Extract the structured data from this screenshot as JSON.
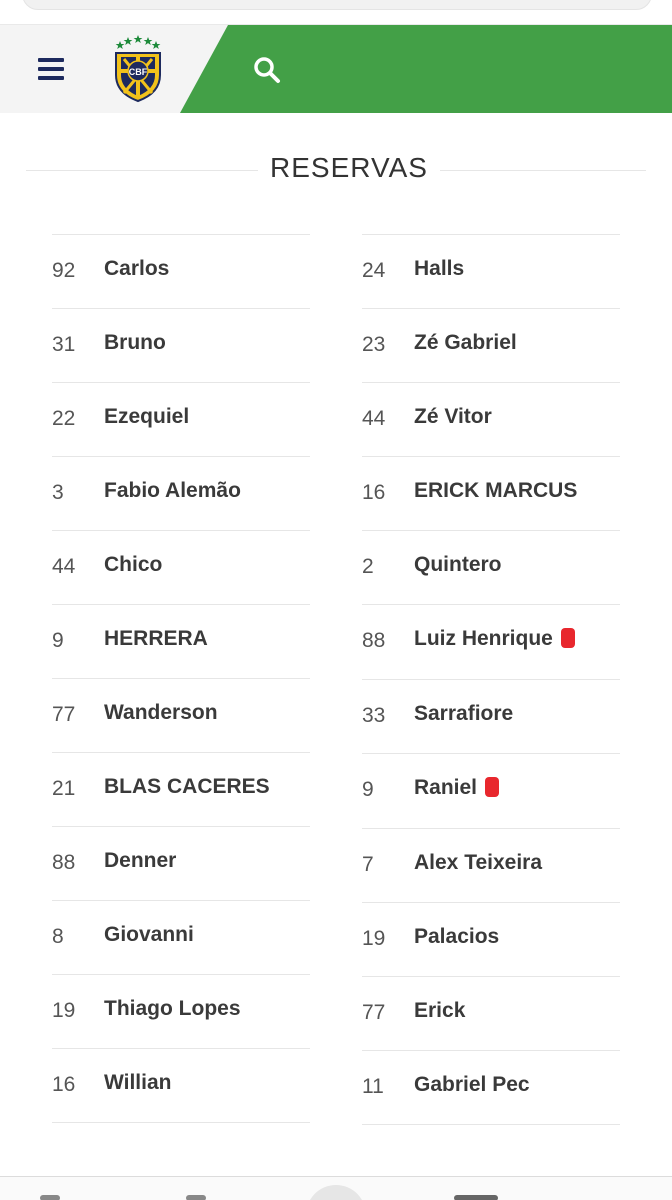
{
  "header": {
    "menu_icon": "hamburger-menu-icon",
    "logo_icon": "cbf-crest-icon",
    "logo_text": "CBF",
    "search_icon": "search-icon",
    "accent_color": "#43a047",
    "brand_navy": "#1d2a5e"
  },
  "section": {
    "title": "RESERVAS"
  },
  "left_column": [
    {
      "number": "92",
      "name": "Carlos",
      "red_card": false
    },
    {
      "number": "31",
      "name": "Bruno",
      "red_card": false
    },
    {
      "number": "22",
      "name": "Ezequiel",
      "red_card": false
    },
    {
      "number": "3",
      "name": "Fabio Alemão",
      "red_card": false
    },
    {
      "number": "44",
      "name": "Chico",
      "red_card": false
    },
    {
      "number": "9",
      "name": "HERRERA",
      "red_card": false
    },
    {
      "number": "77",
      "name": "Wanderson",
      "red_card": false
    },
    {
      "number": "21",
      "name": "BLAS CACERES",
      "red_card": false
    },
    {
      "number": "88",
      "name": "Denner",
      "red_card": false
    },
    {
      "number": "8",
      "name": "Giovanni",
      "red_card": false
    },
    {
      "number": "19",
      "name": "Thiago Lopes",
      "red_card": false
    },
    {
      "number": "16",
      "name": "Willian",
      "red_card": false
    }
  ],
  "right_column": [
    {
      "number": "24",
      "name": "Halls",
      "red_card": false
    },
    {
      "number": "23",
      "name": "Zé Gabriel",
      "red_card": false
    },
    {
      "number": "44",
      "name": "Zé Vitor",
      "red_card": false
    },
    {
      "number": "16",
      "name": "ERICK MARCUS",
      "red_card": false
    },
    {
      "number": "2",
      "name": "Quintero",
      "red_card": false
    },
    {
      "number": "88",
      "name": "Luiz Henrique",
      "red_card": true
    },
    {
      "number": "33",
      "name": "Sarrafiore",
      "red_card": false
    },
    {
      "number": "9",
      "name": "Raniel",
      "red_card": true
    },
    {
      "number": "7",
      "name": "Alex Teixeira",
      "red_card": false
    },
    {
      "number": "19",
      "name": "Palacios",
      "red_card": false
    },
    {
      "number": "77",
      "name": "Erick",
      "red_card": false
    },
    {
      "number": "11",
      "name": "Gabriel Pec",
      "red_card": false
    }
  ],
  "red_card_color": "#e8272d",
  "red_card_icon": "red-card-icon"
}
